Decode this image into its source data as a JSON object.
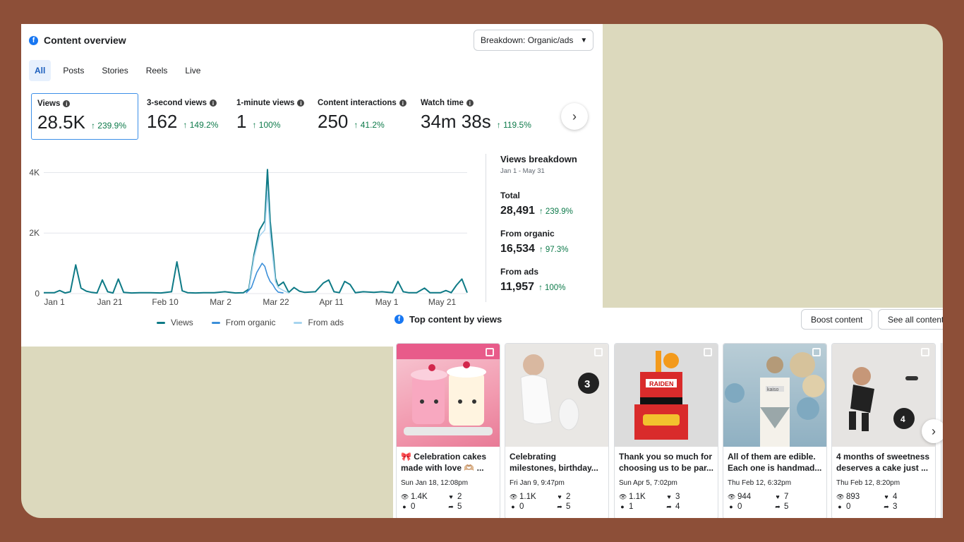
{
  "overview": {
    "title": "Content overview",
    "breakdown_label": "Breakdown: Organic/ads",
    "tabs": [
      "All",
      "Posts",
      "Stories",
      "Reels",
      "Live"
    ],
    "metrics": [
      {
        "label": "Views",
        "value": "28.5K",
        "change": "↑ 239.9%"
      },
      {
        "label": "3-second views",
        "value": "162",
        "change": "↑ 149.2%"
      },
      {
        "label": "1-minute views",
        "value": "1",
        "change": "↑ 100%"
      },
      {
        "label": "Content interactions",
        "value": "250",
        "change": "↑ 41.2%"
      },
      {
        "label": "Watch time",
        "value": "34m 38s",
        "change": "↑ 119.5%"
      }
    ],
    "legend": [
      "Views",
      "From organic",
      "From ads"
    ],
    "colors": {
      "views": "#0e7a86",
      "organic": "#3b8fd9",
      "ads": "#a6d4ef",
      "positive": "#0d7a4a",
      "accent": "#1877f2"
    }
  },
  "breakdown": {
    "title": "Views breakdown",
    "date": "Jan 1 - May 31",
    "items": [
      {
        "label": "Total",
        "value": "28,491",
        "change": "↑ 239.9%"
      },
      {
        "label": "From organic",
        "value": "16,534",
        "change": "↑ 97.3%"
      },
      {
        "label": "From ads",
        "value": "11,957",
        "change": "↑ 100%"
      }
    ]
  },
  "chart_data": {
    "type": "line",
    "x_ticks": [
      "Jan 1",
      "Jan 21",
      "Feb 10",
      "Mar 2",
      "Mar 22",
      "Apr 11",
      "May 1",
      "May 21"
    ],
    "y_ticks": [
      "0",
      "2K",
      "4K"
    ],
    "ylim": [
      0,
      4500
    ],
    "series": [
      {
        "name": "Views",
        "points": [
          [
            0,
            30
          ],
          [
            4,
            30
          ],
          [
            6,
            100
          ],
          [
            8,
            20
          ],
          [
            10,
            60
          ],
          [
            12,
            950
          ],
          [
            14,
            180
          ],
          [
            16,
            80
          ],
          [
            18,
            40
          ],
          [
            20,
            20
          ],
          [
            22,
            450
          ],
          [
            24,
            60
          ],
          [
            26,
            20
          ],
          [
            28,
            480
          ],
          [
            30,
            40
          ],
          [
            33,
            20
          ],
          [
            36,
            30
          ],
          [
            40,
            30
          ],
          [
            44,
            20
          ],
          [
            48,
            60
          ],
          [
            50,
            1050
          ],
          [
            52,
            90
          ],
          [
            54,
            30
          ],
          [
            57,
            20
          ],
          [
            60,
            30
          ],
          [
            64,
            30
          ],
          [
            68,
            60
          ],
          [
            72,
            20
          ],
          [
            75,
            30
          ],
          [
            77,
            150
          ],
          [
            79,
            1300
          ],
          [
            81,
            2100
          ],
          [
            83,
            2400
          ],
          [
            84,
            4100
          ],
          [
            85,
            2400
          ],
          [
            86,
            1500
          ],
          [
            87,
            500
          ],
          [
            88,
            250
          ],
          [
            90,
            380
          ],
          [
            92,
            40
          ],
          [
            94,
            200
          ],
          [
            96,
            80
          ],
          [
            98,
            40
          ],
          [
            102,
            60
          ],
          [
            105,
            350
          ],
          [
            107,
            450
          ],
          [
            109,
            60
          ],
          [
            111,
            30
          ],
          [
            113,
            400
          ],
          [
            115,
            300
          ],
          [
            117,
            30
          ],
          [
            120,
            60
          ],
          [
            124,
            40
          ],
          [
            127,
            60
          ],
          [
            131,
            30
          ],
          [
            133,
            400
          ],
          [
            135,
            60
          ],
          [
            137,
            30
          ],
          [
            140,
            30
          ],
          [
            143,
            180
          ],
          [
            145,
            30
          ],
          [
            149,
            30
          ],
          [
            151,
            100
          ],
          [
            153,
            30
          ],
          [
            155,
            280
          ],
          [
            157,
            480
          ],
          [
            159,
            30
          ]
        ]
      },
      {
        "name": "From organic",
        "points": [
          [
            76,
            20
          ],
          [
            78,
            200
          ],
          [
            80,
            700
          ],
          [
            82,
            1000
          ],
          [
            83,
            900
          ],
          [
            84,
            600
          ],
          [
            85,
            400
          ],
          [
            86,
            300
          ],
          [
            87,
            150
          ],
          [
            88,
            50
          ],
          [
            90,
            20
          ]
        ]
      },
      {
        "name": "From ads",
        "points": [
          [
            77,
            100
          ],
          [
            79,
            1200
          ],
          [
            81,
            1900
          ],
          [
            83,
            2100
          ],
          [
            84,
            3400
          ],
          [
            85,
            2000
          ],
          [
            86,
            1200
          ],
          [
            87,
            400
          ],
          [
            88,
            200
          ],
          [
            90,
            100
          ],
          [
            92,
            20
          ]
        ]
      }
    ]
  },
  "top_content": {
    "title": "Top content by views",
    "boost_label": "Boost content",
    "see_all_label": "See all content",
    "posts": [
      {
        "caption": "🎀 Celebration cakes made with love 🫶🏼 ...",
        "date": "Sun Jan 18, 12:08pm",
        "views": "1.4K",
        "likes": "2",
        "comments": "0",
        "shares": "5",
        "bg": "#f2b8c6"
      },
      {
        "caption": "Celebrating milestones, birthday...",
        "date": "Fri Jan 9, 9:47pm",
        "views": "1.1K",
        "likes": "2",
        "comments": "0",
        "shares": "5",
        "bg": "#e8e6e3"
      },
      {
        "caption": "Thank you so much for choosing us to be par...",
        "date": "Sun Apr 5, 7:02pm",
        "views": "1.1K",
        "likes": "3",
        "comments": "1",
        "shares": "4",
        "bg": "#d9d9d9"
      },
      {
        "caption": "All of them are edible. Each one is handmad...",
        "date": "Thu Feb 12, 6:32pm",
        "views": "944",
        "likes": "7",
        "comments": "0",
        "shares": "5",
        "bg": "#c9d8dc"
      },
      {
        "caption": "4 months of sweetness deserves a cake just ...",
        "date": "Thu Feb 12, 8:20pm",
        "views": "893",
        "likes": "4",
        "comments": "0",
        "shares": "3",
        "bg": "#e4e2e0"
      }
    ]
  }
}
